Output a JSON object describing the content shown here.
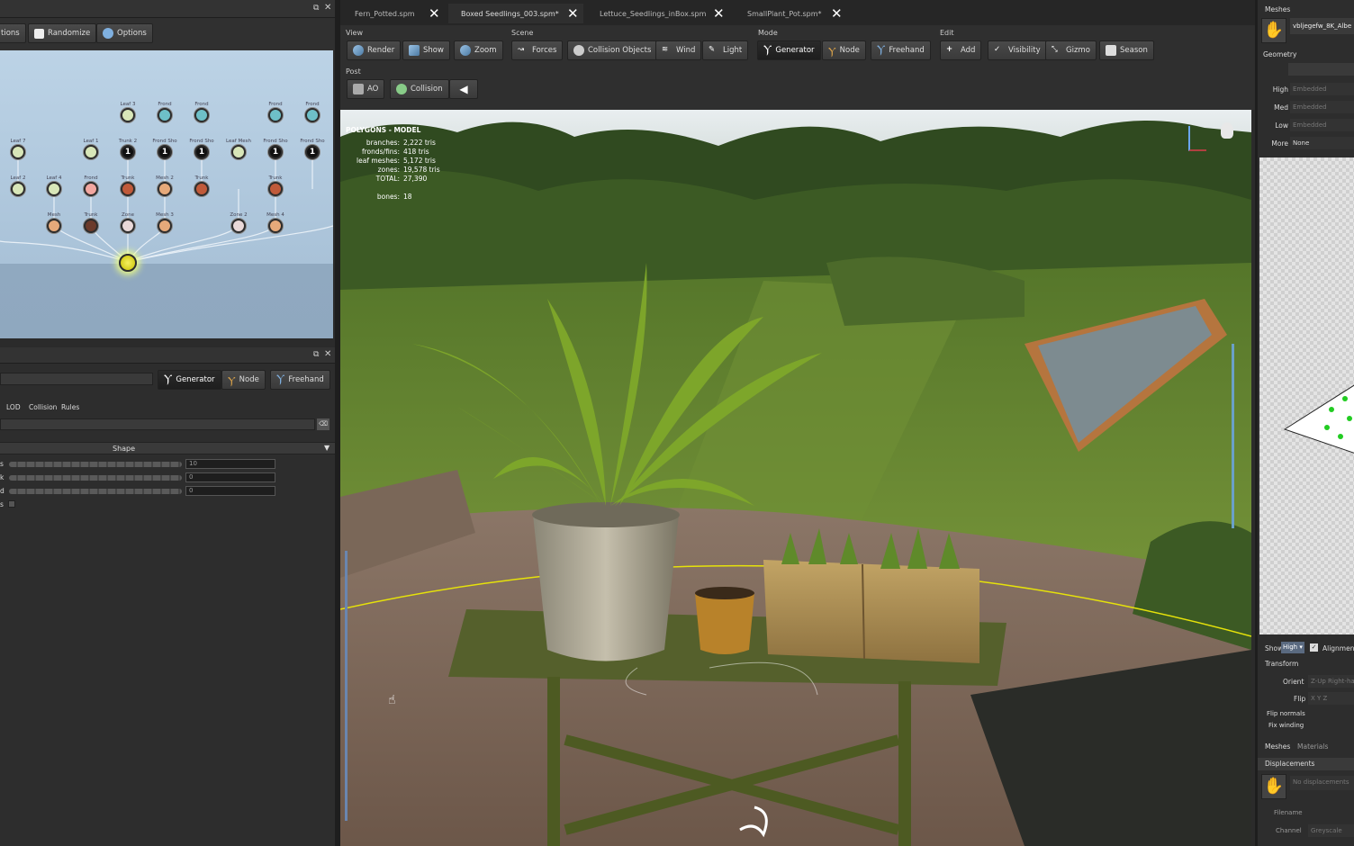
{
  "left_toolbar": {
    "actions_label": "tions",
    "randomize_label": "Randomize",
    "options_label": "Options"
  },
  "graph_nodes": [
    {
      "label": "Leaf 3",
      "color": "#d8e6b8"
    },
    {
      "label": "Frond",
      "color": "#6ec0c8"
    },
    {
      "label": "Frond",
      "color": "#6ec0c8"
    },
    {
      "label": "Frond",
      "color": "#6ec0c8"
    },
    {
      "label": "Frond",
      "color": "#6ec0c8"
    },
    {
      "label": "Leaf 7",
      "color": "#d8e6b8"
    },
    {
      "label": "Leaf 1",
      "color": "#d8e6b8"
    },
    {
      "label": "Trunk 2",
      "color": "#111111"
    },
    {
      "label": "Frond Sho",
      "color": "#111111"
    },
    {
      "label": "Frond Sho",
      "color": "#111111"
    },
    {
      "label": "Leaf Mesh",
      "color": "#d8e6b8"
    },
    {
      "label": "Frond Sho",
      "color": "#111111"
    },
    {
      "label": "Frond Sho",
      "color": "#111111"
    },
    {
      "label": "Leaf 2",
      "color": "#d8e6b8"
    },
    {
      "label": "Leaf 4",
      "color": "#d8e6b8"
    },
    {
      "label": "Frond",
      "color": "#f2a7a0"
    },
    {
      "label": "Trunk",
      "color": "#c05a3a"
    },
    {
      "label": "Mesh 2",
      "color": "#e6a97a"
    },
    {
      "label": "Trunk",
      "color": "#c05a3a"
    },
    {
      "label": "Trunk",
      "color": "#c05a3a"
    },
    {
      "label": "Mesh",
      "color": "#e6a97a"
    },
    {
      "label": "Trunk",
      "color": "#6b3a2a"
    },
    {
      "label": "Zone",
      "color": "#e9d8d8"
    },
    {
      "label": "Mesh 3",
      "color": "#e6a97a"
    },
    {
      "label": "Zone 2",
      "color": "#e9d8d8"
    },
    {
      "label": "Mesh 4",
      "color": "#e6a97a"
    }
  ],
  "node_glyph": "1",
  "properties": {
    "mode_generator": "Generator",
    "mode_node": "Node",
    "mode_freehand": "Freehand",
    "tabs": [
      "LOD",
      "Collision",
      "Rules"
    ],
    "section": "Shape",
    "rows": [
      {
        "label": "s",
        "value": "10"
      },
      {
        "label": "k",
        "value": "0"
      },
      {
        "label": "d",
        "value": "0"
      },
      {
        "label": "s",
        "value": ""
      }
    ]
  },
  "doc_tabs": [
    {
      "label": "Fern_Potted.spm"
    },
    {
      "label": "Boxed Seedlings_003.spm*"
    },
    {
      "label": "Lettuce_Seedlings_inBox.spm"
    },
    {
      "label": "SmallPlant_Pot.spm*"
    }
  ],
  "toolbar_groups": {
    "view": {
      "title": "View",
      "buttons": [
        "Render",
        "Show",
        "Zoom"
      ]
    },
    "scene": {
      "title": "Scene",
      "buttons": [
        "Forces",
        "Collision Objects",
        "Wind",
        "Light"
      ]
    },
    "mode": {
      "title": "Mode",
      "buttons": [
        "Generator",
        "Node",
        "Freehand"
      ]
    },
    "edit": {
      "title": "Edit",
      "buttons": [
        "Add",
        "Visibility",
        "Gizmo",
        "Season"
      ]
    },
    "post": {
      "title": "Post",
      "buttons": [
        "AO",
        "Collision"
      ]
    }
  },
  "stats": {
    "title": "POLYGONS - MODEL",
    "lines": [
      {
        "label": "branches:",
        "value": "2,222 tris"
      },
      {
        "label": "fronds/fins:",
        "value": "418 tris"
      },
      {
        "label": "leaf meshes:",
        "value": "5,172 tris"
      },
      {
        "label": "zones:",
        "value": "19,578 tris"
      },
      {
        "label": "TOTAL:",
        "value": "27,390"
      },
      {
        "label": "bones:",
        "value": "18"
      }
    ]
  },
  "right_panel": {
    "meshes_title": "Meshes",
    "mesh_name": "vbljegefw_8K_Albe",
    "geometry_title": "Geometry",
    "lod_rows": [
      {
        "label": "High",
        "value": "Embedded"
      },
      {
        "label": "Med",
        "value": "Embedded"
      },
      {
        "label": "Low",
        "value": "Embedded"
      },
      {
        "label": "More",
        "value": "None"
      }
    ],
    "show_label": "Show",
    "show_value": "High",
    "alignment_label": "Alignment",
    "transform_title": "Transform",
    "orient_label": "Orient",
    "orient_value": "Z-Up Right-ha",
    "flip_label": "Flip",
    "flip_value": "X Y Z",
    "flip_normals_label": "Flip normals",
    "fix_winding_label": "Fix winding",
    "tab_meshes": "Meshes",
    "tab_materials": "Materials",
    "displacements_title": "Displacements",
    "no_disp": "No displacements",
    "filename_label": "Filename",
    "channel_label": "Channel",
    "channel_value": "Greyscale"
  }
}
